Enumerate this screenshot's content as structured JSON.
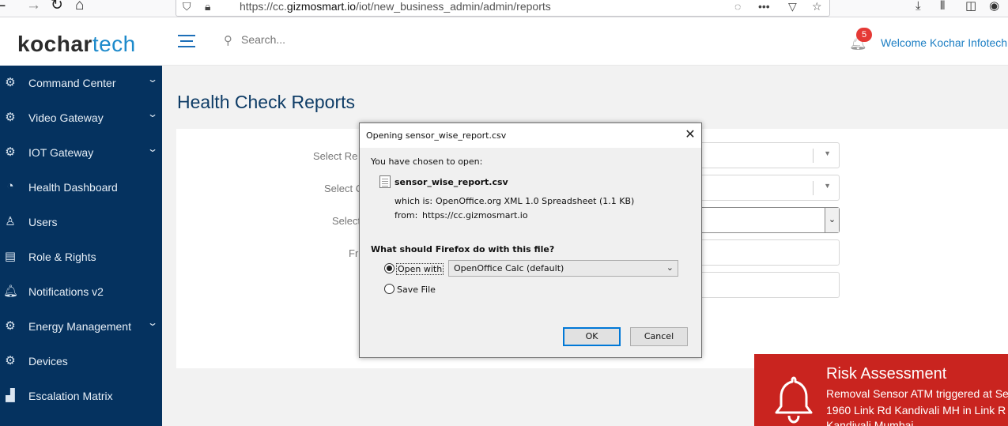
{
  "browser": {
    "url_prefix": "https://cc.",
    "url_domain": "gizmosmart.io",
    "url_path": "/iot/new_business_admin/admin/reports",
    "overflow_icon": "•••"
  },
  "header": {
    "logo_part1": "kochar",
    "logo_part2": "tech",
    "search_placeholder": "Search...",
    "notification_count": "5",
    "welcome_text": "Welcome Kochar Infotech"
  },
  "sidebar": {
    "items": [
      {
        "label": "Command Center",
        "icon": "gear-icon"
      },
      {
        "label": "Video Gateway",
        "icon": "gear-icon"
      },
      {
        "label": "IOT Gateway",
        "icon": "gear-icon"
      },
      {
        "label": "Health Dashboard",
        "icon": "dashboard-icon"
      },
      {
        "label": "Users",
        "icon": "user-icon"
      },
      {
        "label": "Role & Rights",
        "icon": "document-icon"
      },
      {
        "label": "Notifications v2",
        "icon": "bell-icon"
      },
      {
        "label": "Energy Management",
        "icon": "gear-icon"
      },
      {
        "label": "Devices",
        "icon": "gear-icon"
      },
      {
        "label": "Escalation Matrix",
        "icon": "chart-icon"
      }
    ]
  },
  "page": {
    "title": "Health Check Reports",
    "labels": [
      "Select Re",
      "Select C",
      "Select",
      "Fr"
    ]
  },
  "dialog": {
    "title": "Opening sensor_wise_report.csv",
    "chosen_text": "You have chosen to open:",
    "filename": "sensor_wise_report.csv",
    "which_is_label": "which is:",
    "which_is_value": "OpenOffice.org XML 1.0 Spreadsheet (1.1 KB)",
    "from_label": "from:",
    "from_value": "https://cc.gizmosmart.io",
    "question": "What should Firefox do with this file?",
    "open_with_label": "Open with",
    "open_with_app": "OpenOffice Calc (default)",
    "save_file_label": "Save File",
    "ok_label": "OK",
    "cancel_label": "Cancel",
    "close_glyph": "✕"
  },
  "toast": {
    "title": "Risk Assessment",
    "line1": "Removal Sensor ATM triggered at Se",
    "line2": "1960 Link Rd Kandivali MH in Link R",
    "line3": "Kandivali Mumbai",
    "color": "#c9241f"
  }
}
